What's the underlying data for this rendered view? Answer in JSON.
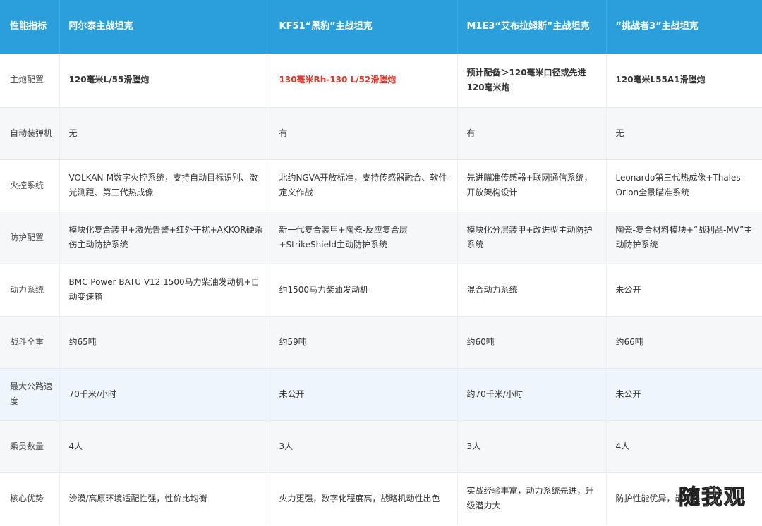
{
  "header": {
    "metric": "性能指标",
    "tanks": [
      "阿尔泰主战坦克",
      "KF51“黑豹”主战坦克",
      "M1E3“艾布拉姆斯”主战坦克",
      "“挑战者3”主战坦克"
    ]
  },
  "rows": [
    {
      "label": "主炮配置",
      "cells": [
        "120毫米L/55滑膛炮",
        "130毫米Rh-130 L/52滑膛炮",
        "预计配备＞120毫米口径或先进120毫米炮",
        "120毫米L55A1滑膛炮"
      ]
    },
    {
      "label": "自动装弹机",
      "cells": [
        "无",
        "有",
        "有",
        "无"
      ]
    },
    {
      "label": "火控系统",
      "cells": [
        "VOLKAN-M数字火控系统，支持自动目标识别、激光测距、第三代热成像",
        "北约NGVA开放标准，支持传感器融合、软件定义作战",
        "先进瞄准传感器+联网通信系统，开放架构设计",
        "Leonardo第三代热成像+Thales Orion全景瞄准系统"
      ]
    },
    {
      "label": "防护配置",
      "cells": [
        "模块化复合装甲+激光告警+红外干扰+AKKOR硬杀伤主动防护系统",
        "新一代复合装甲+陶瓷-反应复合层+StrikeShield主动防护系统",
        "模块化分层装甲+改进型主动防护系统",
        "陶瓷-复合材料模块+“战利品-MV”主动防护系统"
      ]
    },
    {
      "label": "动力系统",
      "cells": [
        "BMC Power BATU V12 1500马力柴油发动机+自动变速箱",
        "约1500马力柴油发动机",
        "混合动力系统",
        "未公开"
      ]
    },
    {
      "label": "战斗全重",
      "cells": [
        "约65吨",
        "约59吨",
        "约60吨",
        "约66吨"
      ]
    },
    {
      "label": "最大公路速度",
      "cells": [
        "70千米/小时",
        "未公开",
        "约70千米/小时",
        "未公开"
      ]
    },
    {
      "label": "乘员数量",
      "cells": [
        "4人",
        "3人",
        "3人",
        "4人"
      ]
    },
    {
      "label": "核心优势",
      "cells": [
        "沙漠/高原环境适配性强，性价比均衡",
        "火力更强，数字化程度高，战略机动性出色",
        "实战经验丰富，动力系统先进，升级潜力大",
        "防护性能优异，能力强"
      ]
    }
  ],
  "watermark": "随我观"
}
